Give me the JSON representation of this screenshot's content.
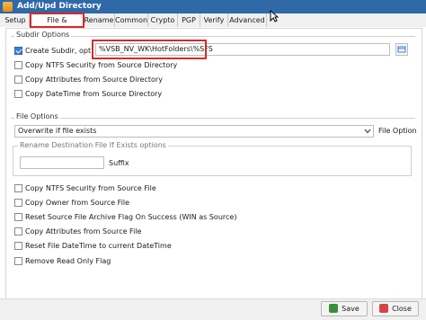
{
  "window": {
    "title": "Add/Upd Directory"
  },
  "tabs": [
    {
      "label": "Setup"
    },
    {
      "label": "File & Directory"
    },
    {
      "label": "Rename"
    },
    {
      "label": "Common"
    },
    {
      "label": "Crypto"
    },
    {
      "label": "PGP"
    },
    {
      "label": "Verify"
    },
    {
      "label": "Advanced"
    }
  ],
  "active_tab": "File & Directory",
  "subdir": {
    "group_label": "Subdir Options",
    "create_subdir_label": "Create Subdir, opt.",
    "create_subdir_checked": true,
    "subdir_value": "%VSB_NV_WK\\HotFolders\\%SFS",
    "copy_ntfs_label": "Copy NTFS Security from Source Directory",
    "copy_attr_label": "Copy Attributes from Source Directory",
    "copy_datetime_label": "Copy DateTime from Source Directory"
  },
  "file_options": {
    "group_label": "File Options",
    "overwrite_value": "Overwrite if file exists",
    "file_option_label": "File Option",
    "rename_group_label": "Rename Destination File If Exists options",
    "suffix_value": "",
    "suffix_label": "Suffix",
    "checks": [
      {
        "label": "Copy NTFS Security from Source File"
      },
      {
        "label": "Copy Owner from Source File"
      },
      {
        "label": "Reset Source File Archive Flag On Success (WIN as Source)"
      },
      {
        "label": "Copy Attributes from Source File"
      },
      {
        "label": "Reset File DateTime to current DateTime"
      },
      {
        "label": "Remove Read Only Flag"
      }
    ]
  },
  "footer": {
    "save_label": "Save",
    "close_label": "Close"
  },
  "colors": {
    "titlebar": "#2f69a8",
    "highlight": "#d62a2a",
    "accent": "#3b7dd8"
  }
}
